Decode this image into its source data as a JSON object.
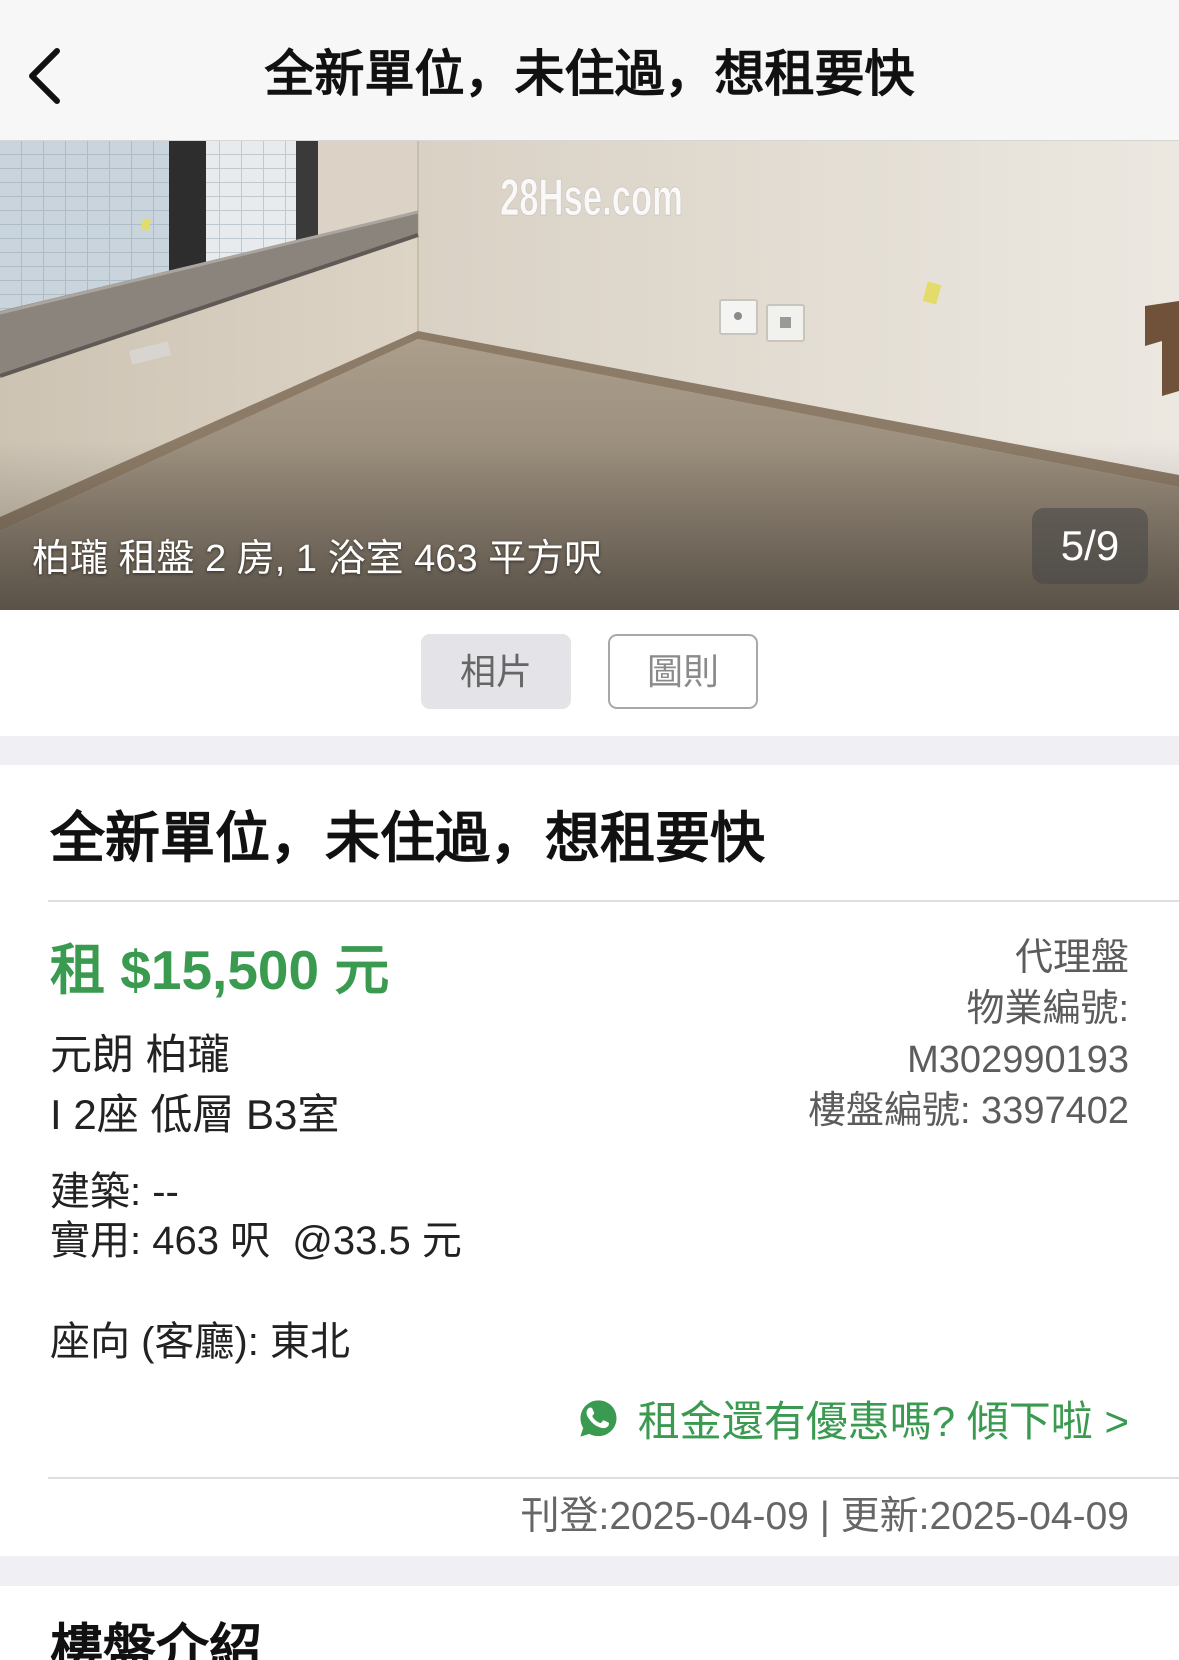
{
  "header": {
    "title": "全新單位，未住過，想租要快"
  },
  "gallery": {
    "watermark": "28Hse.com",
    "caption": "柏瓏 租盤 2 房, 1 浴室 463 平方呎",
    "counter": "5/9",
    "tabs": [
      {
        "label": "相片",
        "selected": true
      },
      {
        "label": "圖則",
        "selected": false
      }
    ]
  },
  "listing": {
    "title": "全新單位，未住過，想租要快",
    "price": "租 $15,500 元",
    "listing_type": "代理盤",
    "property_no_label": "物業編號:",
    "property_no": "M302990193",
    "listing_no": "樓盤編號: 3397402",
    "district_estate": "元朗 柏瓏",
    "unit": "I 2座 低層 B3室",
    "gross_area": "建築: --",
    "saleable_area": "實用: 463 呎  @33.5 元",
    "facing": "座向 (客廳): 東北",
    "whatsapp_cta": "租金還有優惠嗎? 傾下啦 >",
    "dates": "刊登:2025-04-09 | 更新:2025-04-09"
  },
  "estate_section": {
    "title": "樓盤介紹"
  },
  "icons": {
    "back": "chevron-left-icon",
    "whatsapp": "whatsapp-icon"
  },
  "colors": {
    "accent": "#3a9a50",
    "header_bg": "#f7f7f7",
    "separator": "#f0f0f4",
    "text_primary": "#1a1a1a",
    "text_secondary": "#5c5c5c"
  }
}
